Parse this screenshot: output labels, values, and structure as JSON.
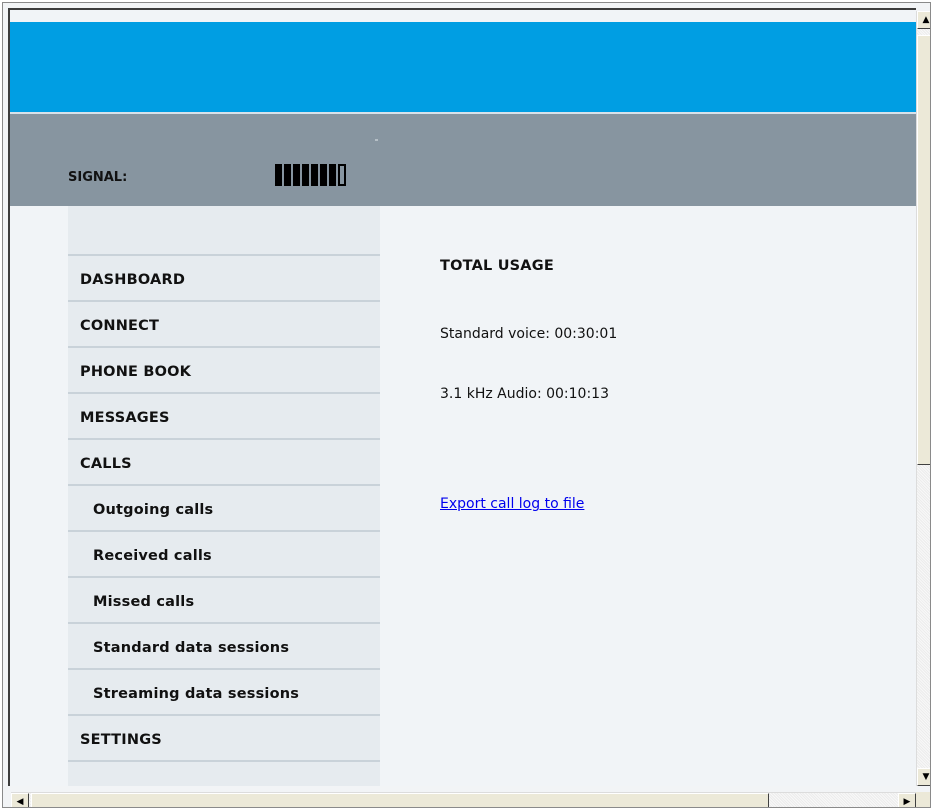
{
  "header": {
    "signal_label": "SIGNAL:",
    "signal_level": {
      "filled": 7,
      "total": 8
    },
    "banner_color": "#009ee3",
    "signal_bar_color": "#8795a0"
  },
  "sidebar": {
    "items": [
      {
        "label": "DASHBOARD",
        "level": "top"
      },
      {
        "label": "CONNECT",
        "level": "top"
      },
      {
        "label": "PHONE BOOK",
        "level": "top"
      },
      {
        "label": "MESSAGES",
        "level": "top"
      },
      {
        "label": "CALLS",
        "level": "top"
      },
      {
        "label": "Outgoing calls",
        "level": "sub"
      },
      {
        "label": "Received calls",
        "level": "sub"
      },
      {
        "label": "Missed calls",
        "level": "sub"
      },
      {
        "label": "Standard data sessions",
        "level": "sub"
      },
      {
        "label": "Streaming data sessions",
        "level": "sub"
      },
      {
        "label": "SETTINGS",
        "level": "top"
      }
    ]
  },
  "main": {
    "heading": "TOTAL USAGE",
    "standard_voice": "Standard voice: 00:30:01",
    "audio_31khz": "3.1 kHz Audio: 00:10:13",
    "export_link": "Export call log to file"
  },
  "scrollbars": {
    "up_arrow": "▲",
    "down_arrow": "▼",
    "left_arrow": "◀",
    "right_arrow": "▶"
  }
}
